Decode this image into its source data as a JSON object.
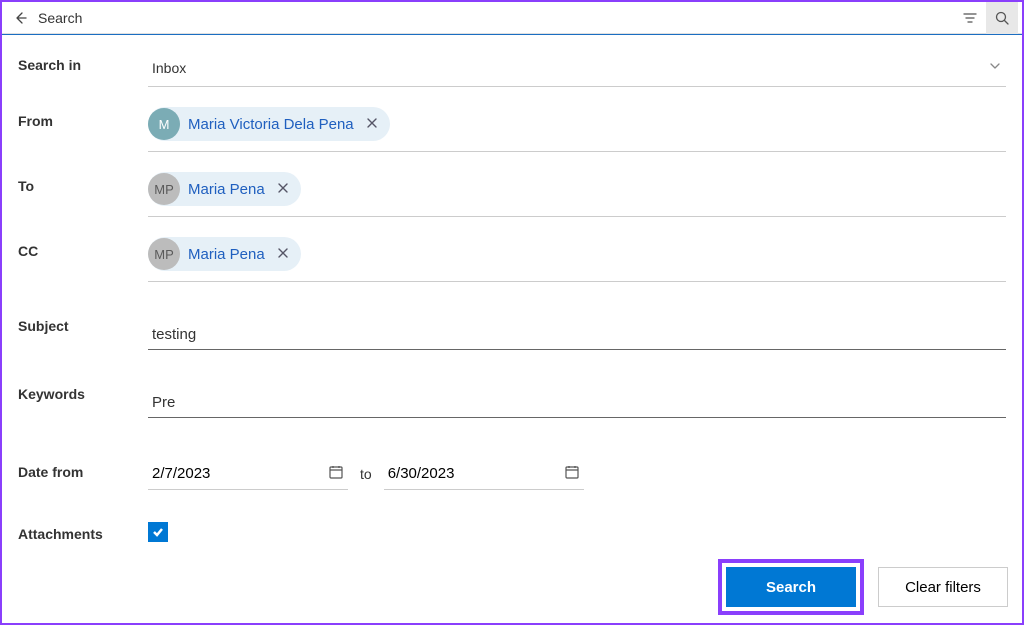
{
  "header": {
    "title": "Search"
  },
  "fields": {
    "search_in": {
      "label": "Search in",
      "value": "Inbox"
    },
    "from": {
      "label": "From",
      "people": [
        {
          "initial": "M",
          "name": "Maria Victoria Dela Pena",
          "avatar_color": "teal"
        }
      ]
    },
    "to": {
      "label": "To",
      "people": [
        {
          "initial": "MP",
          "name": "Maria Pena",
          "avatar_color": "gray"
        }
      ]
    },
    "cc": {
      "label": "CC",
      "people": [
        {
          "initial": "MP",
          "name": "Maria Pena",
          "avatar_color": "gray"
        }
      ]
    },
    "subject": {
      "label": "Subject",
      "value": "testing"
    },
    "keywords": {
      "label": "Keywords",
      "value": "Pre"
    },
    "date": {
      "label": "Date from",
      "from_value": "2/7/2023",
      "separator": "to",
      "to_value": "6/30/2023"
    },
    "attachments": {
      "label": "Attachments",
      "checked": true
    }
  },
  "buttons": {
    "search": "Search",
    "clear": "Clear filters"
  }
}
